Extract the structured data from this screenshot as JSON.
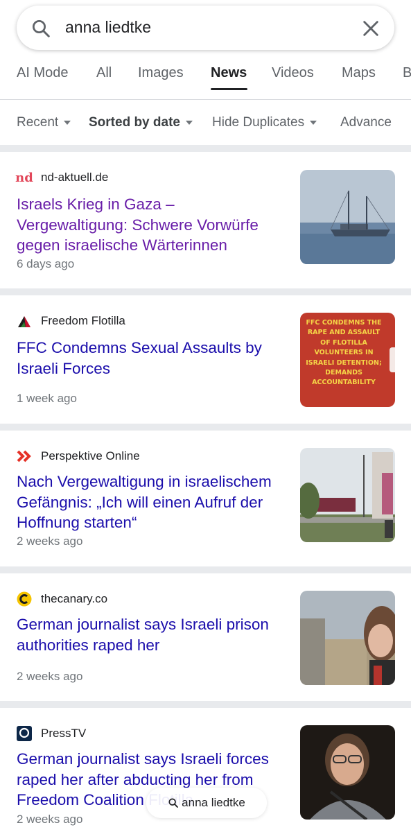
{
  "search": {
    "query": "anna liedtke"
  },
  "tabs": [
    {
      "label": "AI Mode"
    },
    {
      "label": "All"
    },
    {
      "label": "Images"
    },
    {
      "label": "News",
      "active": true
    },
    {
      "label": "Videos"
    },
    {
      "label": "Maps"
    },
    {
      "label": "B"
    }
  ],
  "filters": [
    {
      "label": "Recent"
    },
    {
      "label": "Sorted by date"
    },
    {
      "label": "Hide Duplicates"
    },
    {
      "label": "Advance"
    }
  ],
  "results": [
    {
      "source": "nd-aktuell.de",
      "logo_text": "nd",
      "title": "Israels Krieg in Gaza – Vergewaltigung: Schwere Vorwürfe gegen israelische Wärterinnen",
      "age": "6 days ago",
      "visited": true
    },
    {
      "source": "Freedom Flotilla",
      "title": "FFC Condemns Sexual Assaults by Israeli Forces",
      "age": "1 week ago",
      "thumb_text": "FFC CONDEMNS THE RAPE AND ASSAULT OF FLOTILLA VOLUNTEERS IN ISRAELI DETENTION; DEMANDS ACCOUNTABILITY"
    },
    {
      "source": "Perspektive Online",
      "title": "Nach Vergewaltigung in israelischem Gefängnis: „Ich will einen Aufruf der Hoffnung starten“",
      "age": "2 weeks ago"
    },
    {
      "source": "thecanary.co",
      "title": "German journalist says Israeli prison authorities raped her",
      "age": "2 weeks ago"
    },
    {
      "source": "PressTV",
      "title": "German journalist says Israeli forces raped her after abducting her from Freedom Coalition Flotilla",
      "age": "2 weeks ago"
    }
  ],
  "floating_search": {
    "label": "anna liedtke"
  },
  "colors": {
    "link": "#1a0dab",
    "visited": "#681da8",
    "muted": "#70757a",
    "gap": "#e8eaed"
  }
}
